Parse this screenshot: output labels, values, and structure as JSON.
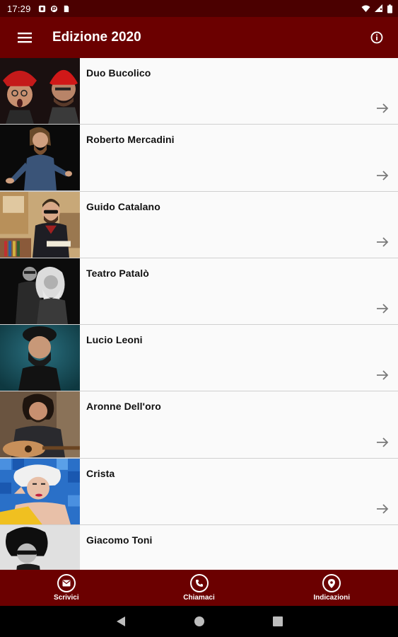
{
  "status_bar": {
    "time": "17:29",
    "left_icons": [
      "notification-icon",
      "app-icon",
      "sim-icon"
    ],
    "right_icons": [
      "wifi-icon",
      "signal-icon",
      "battery-icon"
    ]
  },
  "app_bar": {
    "title": "Edizione 2020",
    "menu_icon": "hamburger-menu-icon",
    "info_icon": "info-icon"
  },
  "artists": [
    {
      "name": "Duo Bucolico",
      "thumb": "photo-duo-bucolico"
    },
    {
      "name": "Roberto Mercadini",
      "thumb": "photo-roberto-mercadini"
    },
    {
      "name": "Guido Catalano",
      "thumb": "photo-guido-catalano"
    },
    {
      "name": "Teatro Patalò",
      "thumb": "photo-teatro-patalo"
    },
    {
      "name": "Lucio Leoni",
      "thumb": "photo-lucio-leoni"
    },
    {
      "name": "Aronne Dell'oro",
      "thumb": "photo-aronne-delloro"
    },
    {
      "name": "Crista",
      "thumb": "photo-crista"
    },
    {
      "name": "Giacomo Toni",
      "thumb": "photo-giacomo-toni"
    }
  ],
  "bottom_nav": [
    {
      "label": "Scrivici",
      "icon": "mail-icon"
    },
    {
      "label": "Chiamaci",
      "icon": "phone-icon"
    },
    {
      "label": "Indicazioni",
      "icon": "location-pin-icon"
    }
  ],
  "colors": {
    "status_bar": "#4b0000",
    "primary": "#6b0000",
    "list_bg": "#fafafa",
    "divider": "#d0d0d0",
    "arrow": "#7a7a7a"
  }
}
